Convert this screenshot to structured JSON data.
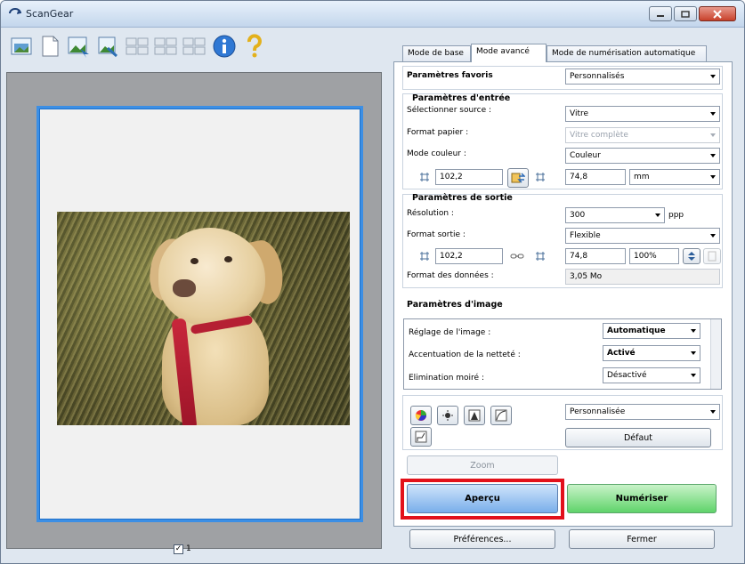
{
  "window": {
    "title": "ScanGear"
  },
  "tabs": [
    {
      "label": "Mode de base"
    },
    {
      "label": "Mode avancé"
    },
    {
      "label": "Mode de numérisation automatique"
    }
  ],
  "favorites": {
    "label": "Paramètres favoris",
    "value": "Personnalisés"
  },
  "input": {
    "title": "Paramètres d'entrée",
    "source_label": "Sélectionner source :",
    "source_value": "Vitre",
    "paper_label": "Format papier :",
    "paper_value": "Vitre complète",
    "color_label": "Mode couleur :",
    "color_value": "Couleur",
    "width": "102,2",
    "height": "74,8",
    "unit": "mm"
  },
  "output": {
    "title": "Paramètres de sortie",
    "resolution_label": "Résolution :",
    "resolution_value": "300",
    "resolution_unit": "ppp",
    "format_label": "Format sortie :",
    "format_value": "Flexible",
    "width": "102,2",
    "height": "74,8",
    "scale": "100%",
    "data_size_label": "Format des données :",
    "data_size_value": "3,05 Mo"
  },
  "image_settings": {
    "title": "Paramètres d'image",
    "items": [
      {
        "label": "Réglage de l'image :",
        "value": "Automatique"
      },
      {
        "label": "Accentuation de la netteté :",
        "value": "Activé"
      },
      {
        "label": "Elimination moiré :",
        "value": "Désactivé"
      }
    ]
  },
  "tone": {
    "preset_value": "Personnalisée",
    "default_label": "Défaut"
  },
  "buttons": {
    "zoom": "Zoom",
    "preview": "Aperçu",
    "scan": "Numériser",
    "preferences": "Préférences...",
    "close": "Fermer"
  },
  "preview": {
    "page_number": "1",
    "page_checked": "✓"
  },
  "colors": {
    "title_bar": "#c3d6ec",
    "selection_frame": "#3c8fe5",
    "highlight": "#e2111b",
    "preview_button": "#79aeea",
    "scan_button": "#5fd36a"
  },
  "icons": [
    "scangear-icon",
    "full-image-icon",
    "page-icon",
    "scan-thumb-icon",
    "crop-icon",
    "grid-icon",
    "grid-icon",
    "grid-icon",
    "info-icon",
    "help-icon"
  ]
}
